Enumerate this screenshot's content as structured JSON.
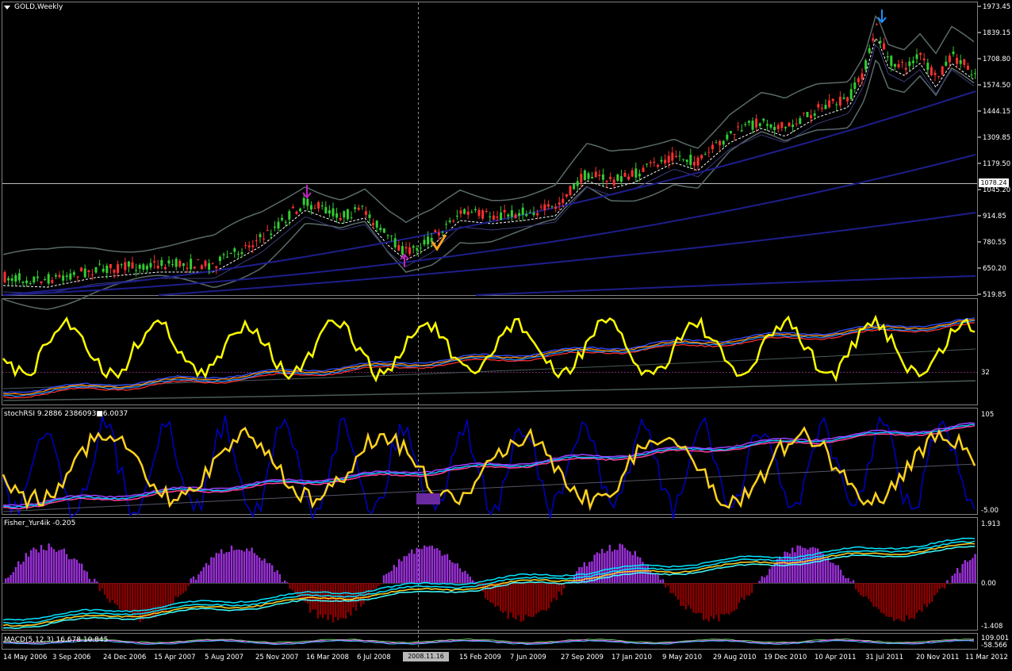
{
  "window": {
    "title": "GOLD,Weekly"
  },
  "panes": {
    "price": {
      "axis_labels": [
        "1973.45",
        "1839.15",
        "1708.80",
        "1574.50",
        "1444.15",
        "1309.85",
        "1179.50",
        "1045.20",
        "914.85",
        "780.55",
        "650.20",
        "519.85"
      ],
      "current_price_marker": "1078.24"
    },
    "rsi": {
      "axis_labels": [
        "32"
      ]
    },
    "stoch": {
      "label": "stochRSI 9.2886 2386093■6.0037",
      "axis_labels": [
        "105",
        "-5.00"
      ]
    },
    "fisher": {
      "label": "Fisher_Yur4ik -0.205",
      "axis_labels": [
        "1.913",
        "0.00",
        "-1.408"
      ]
    },
    "macd": {
      "label": "MACD(5,12,3) 16.678 10.845",
      "axis_labels": [
        "109.001",
        "-58.566"
      ]
    }
  },
  "x_axis": {
    "labels": [
      "14 May 2006",
      "3 Sep 2006",
      "24 Dec 2006",
      "15 Apr 2007",
      "5 Aug 2007",
      "25 Nov 2007",
      "16 Mar 2008",
      "6 Jul 2008",
      "2008.11.16 00:00",
      "15 Feb 2009",
      "7 Jun 2009",
      "27 Sep 2009",
      "17 Jan 2010",
      "9 May 2010",
      "29 Aug 2010",
      "19 Dec 2010",
      "10 Apr 2011",
      "31 Jul 2011",
      "20 Nov 2011",
      "11 Mar 2012"
    ],
    "crosshair_label": "2008.11.16 00:00"
  },
  "colors": {
    "background": "#000000",
    "grid": "#808080",
    "bull_candle": "#32cd32",
    "bear_candle": "#ff3030",
    "rsi_line": "#ffff00",
    "stoch_line": "#ffd21e",
    "stoch_blue": "#0000c8",
    "fisher_pos": "#9b30d9",
    "fisher_neg": "#8b0000",
    "fisher_line": "#00e5ff",
    "ma_blue": "#1e1e8c",
    "bands": "#5a6a6a"
  },
  "icons": [
    "buy-arrow-icon",
    "sell-arrow-icon",
    "checkmark-icon",
    "dropdown-arrow-icon"
  ]
}
